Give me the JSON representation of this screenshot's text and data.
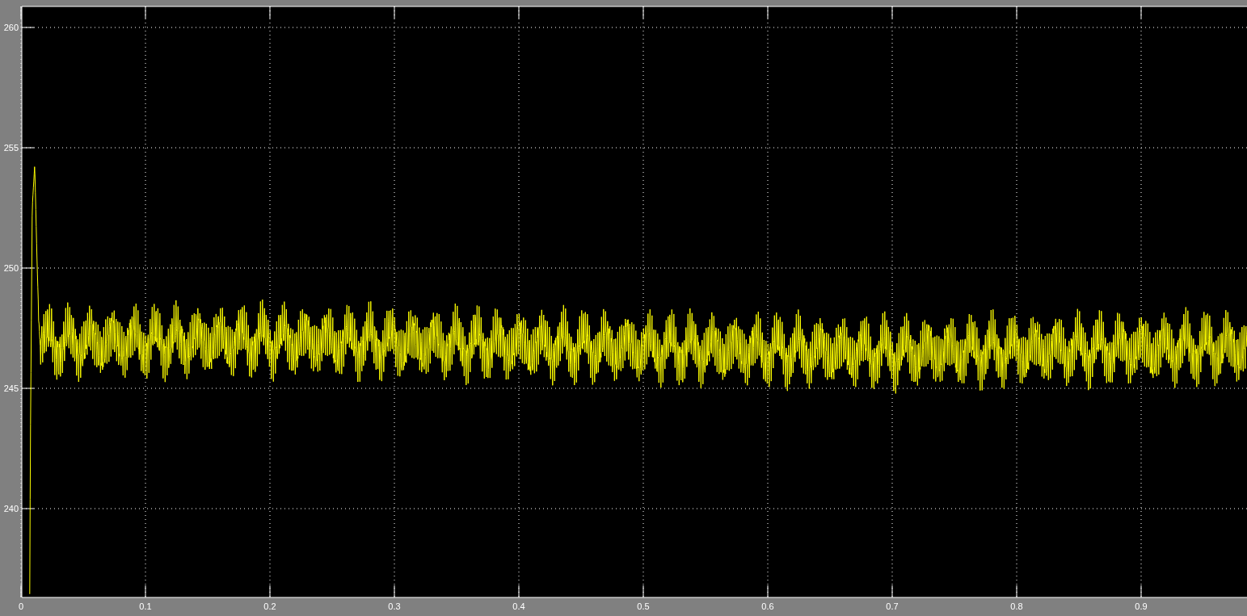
{
  "scope": {
    "y_tick_labels": [
      "260",
      "255",
      "250",
      "245",
      "240"
    ],
    "x_tick_labels": [
      "0",
      "0.1",
      "0.2",
      "0.3",
      "0.4",
      "0.5",
      "0.6",
      "0.7",
      "0.8",
      "0.9"
    ]
  }
}
